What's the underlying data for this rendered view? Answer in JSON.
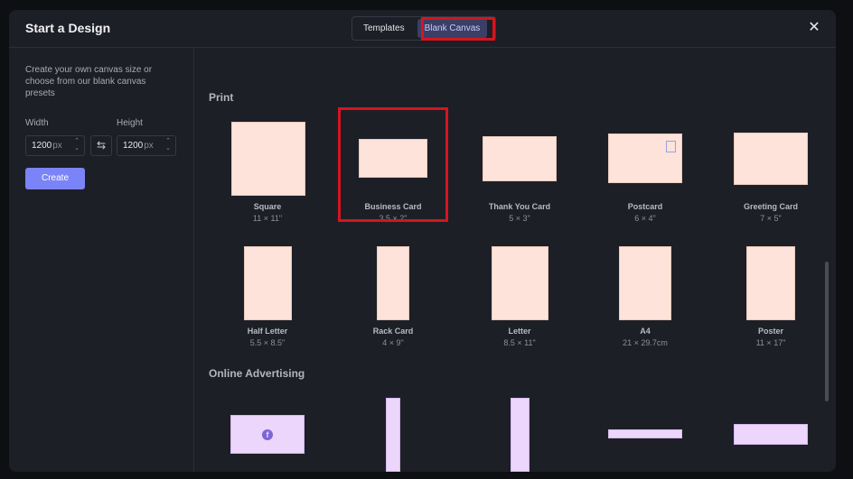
{
  "header": {
    "title": "Start a Design",
    "tabs": [
      {
        "label": "Templates",
        "active": false
      },
      {
        "label": "Blank Canvas",
        "active": true
      }
    ],
    "close_icon": "close-icon"
  },
  "sidebar": {
    "intro": "Create your own canvas size or choose from our blank canvas presets",
    "width_label": "Width",
    "width_value": "1200",
    "width_unit": "px",
    "height_label": "Height",
    "height_value": "1200",
    "height_unit": "px",
    "swap_icon": "swap-icon",
    "create_label": "Create"
  },
  "sections": {
    "print": {
      "title": "Print",
      "items": [
        {
          "name": "Square",
          "size": "11 × 11\""
        },
        {
          "name": "Business Card",
          "size": "3.5 × 2\""
        },
        {
          "name": "Thank You Card",
          "size": "5 × 3\""
        },
        {
          "name": "Postcard",
          "size": "6 × 4\""
        },
        {
          "name": "Greeting Card",
          "size": "7 × 5\""
        },
        {
          "name": "Half Letter",
          "size": "5.5 × 8.5\""
        },
        {
          "name": "Rack Card",
          "size": "4 × 9\""
        },
        {
          "name": "Letter",
          "size": "8.5 × 11\""
        },
        {
          "name": "A4",
          "size": "21 × 29.7cm"
        },
        {
          "name": "Poster",
          "size": "11 × 17\""
        }
      ]
    },
    "online": {
      "title": "Online Advertising",
      "facebook_icon": "f"
    }
  },
  "colors": {
    "accent": "#7b84f7",
    "print_thumb": "#fde3d9",
    "online_thumb": "#ecd6fb",
    "highlight": "#d7141e"
  }
}
